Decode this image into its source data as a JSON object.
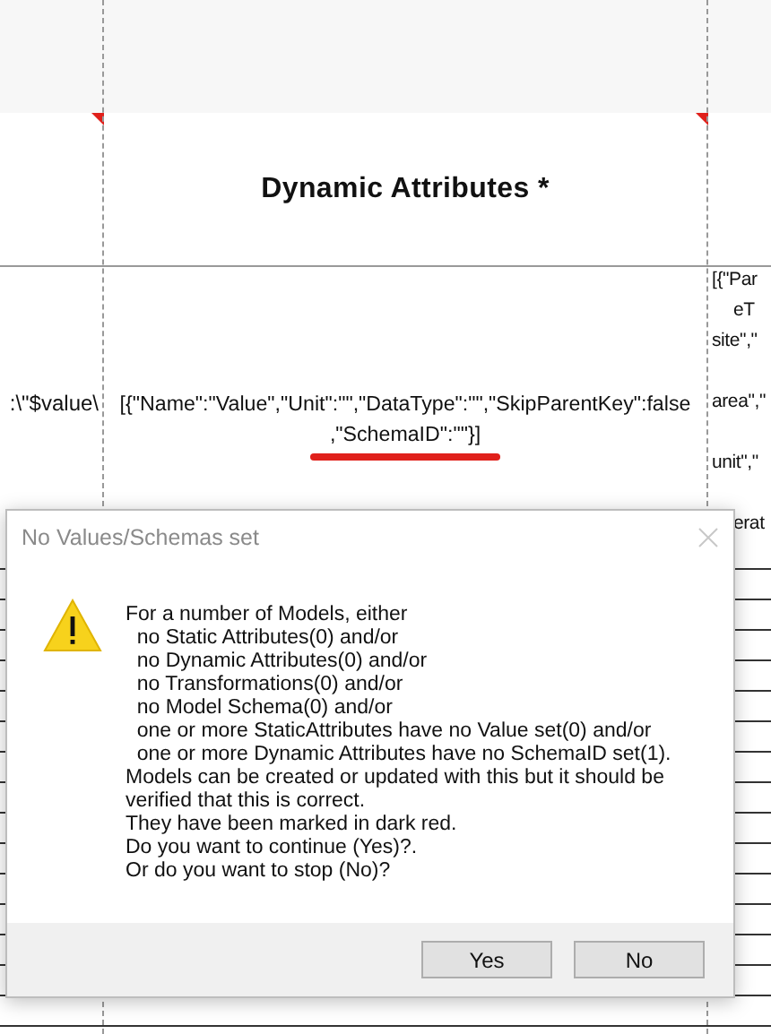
{
  "sheet": {
    "columns": [
      {
        "comment": true,
        "underline_last_line": false,
        "cell_lines": [
          ":\\\"$value\\"
        ]
      },
      {
        "header": "Dynamic Attributes *",
        "comment": true,
        "cell_lines": [
          "[{\"Name\":\"Value\",\"Unit\":\"\",\"DataType\":\"\",\"SkipParentKey\":false",
          ",\"SchemaID\":\"\"}]"
        ],
        "underline_last_line": true
      },
      {
        "comment": false,
        "underline_last_line": false,
        "cell_lines": [
          "[{\"Par",
          "eT",
          "site\",\"",
          "area\",\"",
          "unit\",\"",
          "erat"
        ]
      }
    ]
  },
  "dialog": {
    "title": "No Values/Schemas set",
    "message": "For a number of Models, either\n  no Static Attributes(0) and/or\n  no Dynamic Attributes(0) and/or\n  no Transformations(0) and/or\n  no Model Schema(0) and/or\n  one or more StaticAttributes have no Value set(0) and/or\n  one or more Dynamic Attributes have no SchemaID set(1).\nModels can be created or updated with this but it should be\nverified that this is correct.\nThey have been marked in dark red.\nDo you want to continue (Yes)?.\nOr do you want to stop (No)?",
    "buttons": [
      {
        "label": "Yes"
      },
      {
        "label": "No"
      }
    ]
  }
}
